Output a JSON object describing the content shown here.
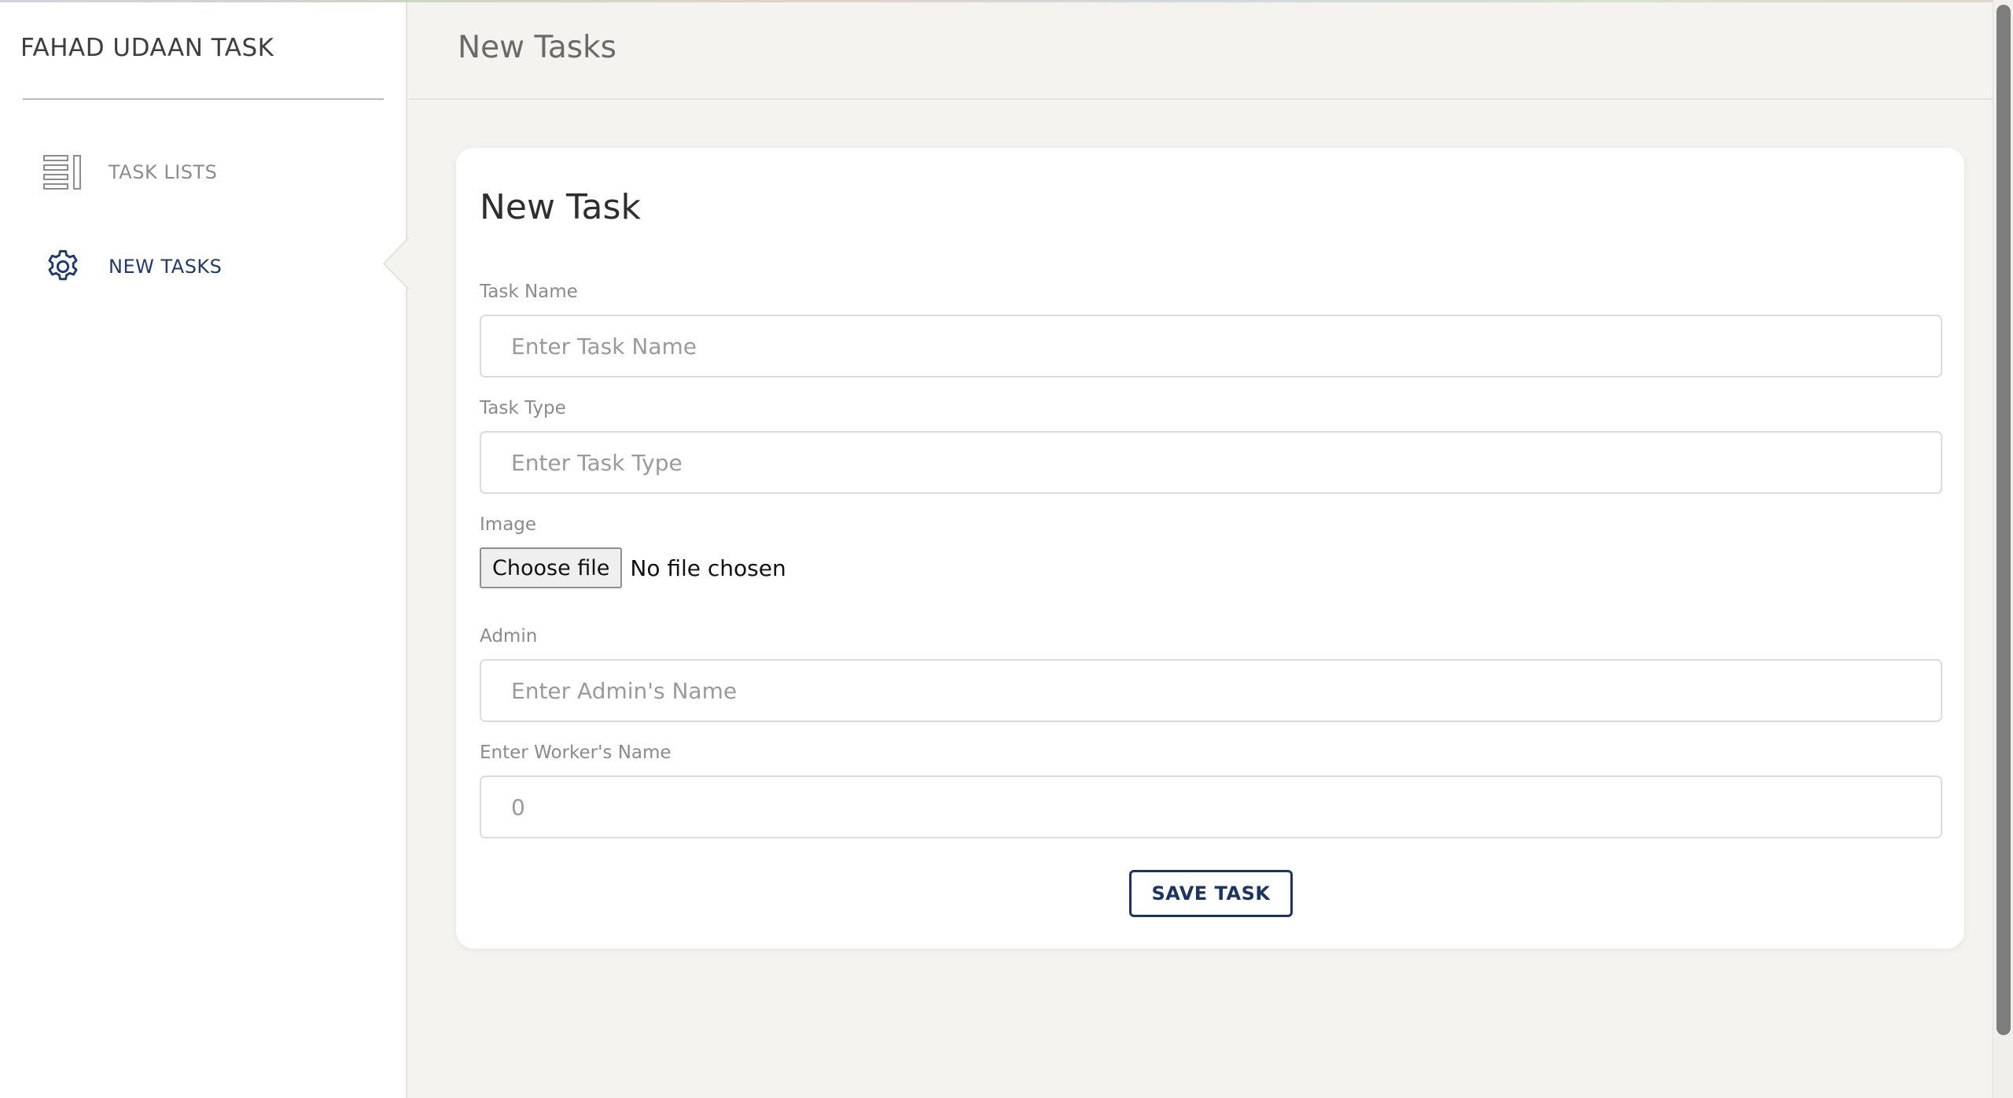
{
  "sidebar": {
    "brand": "FAHAD UDAAN TASK",
    "items": [
      {
        "label": "TASK LISTS",
        "icon": "list-icon",
        "active": false
      },
      {
        "label": "NEW TASKS",
        "icon": "gear-icon",
        "active": true
      }
    ]
  },
  "header": {
    "title": "New Tasks"
  },
  "form": {
    "title": "New Task",
    "task_name": {
      "label": "Task Name",
      "placeholder": "Enter Task Name",
      "value": ""
    },
    "task_type": {
      "label": "Task Type",
      "placeholder": "Enter Task Type",
      "value": ""
    },
    "image": {
      "label": "Image",
      "button": "Choose file",
      "status": "No file chosen"
    },
    "admin": {
      "label": "Admin",
      "placeholder": "Enter Admin's Name",
      "value": ""
    },
    "worker": {
      "label": "Enter Worker's Name",
      "placeholder": "0",
      "value": ""
    },
    "save_label": "SAVE TASK"
  },
  "colors": {
    "accent": "#1d3463",
    "background": "#f4f3ef",
    "card": "#ffffff"
  }
}
